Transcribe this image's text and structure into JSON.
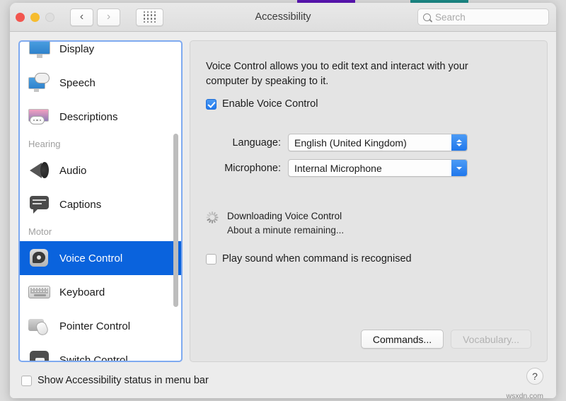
{
  "background_tabs": [
    {
      "name": "purple-tab",
      "color": "#5b16b5"
    },
    {
      "name": "teal-tab",
      "color": "#1c8a87"
    }
  ],
  "titlebar": {
    "title": "Accessibility",
    "back_icon": "‹",
    "forward_icon": "›",
    "grid_icon": "grid-icon",
    "search": {
      "value": "",
      "placeholder": "Search"
    }
  },
  "sidebar": {
    "items": [
      {
        "label": "Display",
        "icon": "display-icon",
        "type": "item",
        "selected": false
      },
      {
        "label": "Speech",
        "icon": "speech-icon",
        "type": "item",
        "selected": false
      },
      {
        "label": "Descriptions",
        "icon": "descriptions-icon",
        "type": "item",
        "selected": false
      },
      {
        "label": "Hearing",
        "icon": "",
        "type": "group",
        "selected": false
      },
      {
        "label": "Audio",
        "icon": "audio-icon",
        "type": "item",
        "selected": false
      },
      {
        "label": "Captions",
        "icon": "captions-icon",
        "type": "item",
        "selected": false
      },
      {
        "label": "Motor",
        "icon": "",
        "type": "group",
        "selected": false
      },
      {
        "label": "Voice Control",
        "icon": "voice-control-icon",
        "type": "item",
        "selected": true
      },
      {
        "label": "Keyboard",
        "icon": "keyboard-icon",
        "type": "item",
        "selected": false
      },
      {
        "label": "Pointer Control",
        "icon": "pointer-control-icon",
        "type": "item",
        "selected": false
      },
      {
        "label": "Switch Control",
        "icon": "switch-control-icon",
        "type": "item",
        "selected": false
      }
    ],
    "selection_color": "#0a63dd",
    "focus_ring_color": "#7faaf0"
  },
  "content": {
    "description": "Voice Control allows you to edit text and interact with your computer by speaking to it.",
    "enable_checkbox": {
      "label": "Enable Voice Control",
      "checked": true
    },
    "fields": [
      {
        "label": "Language:",
        "value": "English (United Kingdom)",
        "arrows": "both"
      },
      {
        "label": "Microphone:",
        "value": "Internal Microphone",
        "arrows": "down"
      }
    ],
    "status": {
      "icon": "spinner-icon",
      "title": "Downloading Voice Control",
      "detail": "About a minute remaining..."
    },
    "play_sound_checkbox": {
      "label": "Play sound when command is recognised",
      "checked": false
    },
    "buttons": [
      {
        "label": "Commands...",
        "disabled": false
      },
      {
        "label": "Vocabulary...",
        "disabled": true
      }
    ]
  },
  "bottom": {
    "show_status_checkbox": {
      "label": "Show Accessibility status in menu bar",
      "checked": false
    },
    "help_label": "?",
    "watermark": "wsxdn.com"
  }
}
